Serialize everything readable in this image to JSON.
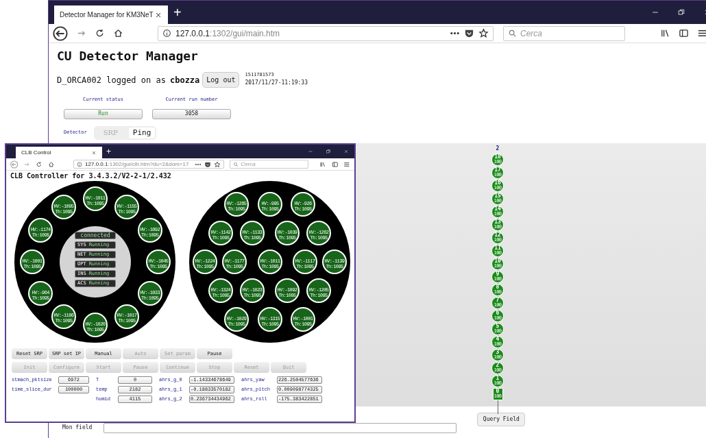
{
  "main_window": {
    "tab_title": "Detector Manager for KM3NeT",
    "new_tab": "+",
    "url_host": "127.0.0.1",
    "url_path": ":1302/gui/main.htm",
    "search_placeholder": "Cerca"
  },
  "page": {
    "title": "CU Detector Manager",
    "login_text": "D_ORCA002 logged on as",
    "user": "cbozza",
    "logout": "Log out",
    "timestamp": "1511781573",
    "datetime": "2017/11/27-11:19:33",
    "status_fields": [
      {
        "label": "Current status",
        "value": "Run",
        "kind": "status"
      },
      {
        "label": "Current run number",
        "value": "3058",
        "kind": "number"
      }
    ],
    "detector_label": "Detector",
    "detector_buttons": [
      {
        "label": "SRP",
        "disabled": true
      },
      {
        "label": "Ping",
        "disabled": false
      }
    ],
    "string": {
      "label": "2",
      "floors": [
        {
          "number": "18",
          "value": "100",
          "kind": "dom"
        },
        {
          "number": "17",
          "value": "100",
          "kind": "dom"
        },
        {
          "number": "16",
          "value": "100",
          "kind": "dom"
        },
        {
          "number": "15",
          "value": "100",
          "kind": "dom"
        },
        {
          "number": "14",
          "value": "100",
          "kind": "dom"
        },
        {
          "number": "13",
          "value": "100",
          "kind": "dom"
        },
        {
          "number": "12",
          "value": "100",
          "kind": "dom"
        },
        {
          "number": "11",
          "value": "100",
          "kind": "dom"
        },
        {
          "number": "10",
          "value": "100",
          "kind": "dom"
        },
        {
          "number": "9",
          "value": "100",
          "kind": "dom"
        },
        {
          "number": "8",
          "value": "100",
          "kind": "dom"
        },
        {
          "number": "7",
          "value": "100",
          "kind": "dom"
        },
        {
          "number": "6",
          "value": "100",
          "kind": "dom"
        },
        {
          "number": "5",
          "value": "100",
          "kind": "dom"
        },
        {
          "number": "4",
          "value": "100",
          "kind": "dom"
        },
        {
          "number": "3",
          "value": "100",
          "kind": "dom"
        },
        {
          "number": "2",
          "value": "100",
          "kind": "dom"
        },
        {
          "number": "1",
          "value": "100",
          "kind": "dom"
        },
        {
          "number": "0",
          "value": "100",
          "kind": "base"
        }
      ]
    },
    "mon_field_label": "Mon field",
    "query_button": "Query Field"
  },
  "clb_window": {
    "tab_title": "CLB Control",
    "new_tab": "+",
    "url_host": "127.0.0.1",
    "url_path": ":1302/gui/clb.htm?du=2&dom=17",
    "search_placeholder": "Cerca",
    "heading": "CLB Controller for 3.4.3.2/V2-2-1/2.432",
    "connection": "connected",
    "subsystems": [
      {
        "name": "SYS",
        "state": "Running"
      },
      {
        "name": "NET",
        "state": "Running"
      },
      {
        "name": "OPT",
        "state": "Running"
      },
      {
        "name": "INS",
        "state": "Running"
      },
      {
        "name": "ACS",
        "state": "Running"
      }
    ],
    "pmts_left": [
      {
        "hv": "HV:-1011",
        "th": "Th:1095"
      },
      {
        "hv": "HV:-1095",
        "th": "Th:1095"
      },
      {
        "hv": "HV:-1155",
        "th": "Th:1095"
      },
      {
        "hv": "HV:-1174",
        "th": "Th:1095"
      },
      {
        "hv": "HV:-1092",
        "th": "Th:1095"
      },
      {
        "hv": "HV:-1001",
        "th": "Th:1095"
      },
      {
        "hv": "HV:-1045",
        "th": "Th:1095"
      },
      {
        "hv": "HV:-964",
        "th": "Th:1095"
      },
      {
        "hv": "HV:-1033",
        "th": "Th:1095"
      },
      {
        "hv": "HV:-1186",
        "th": "Th:1095"
      },
      {
        "hv": "HV:-1017",
        "th": "Th:1095"
      },
      {
        "hv": "HV:-1020",
        "th": "Th:1095"
      }
    ],
    "pmts_right": [
      {
        "hv": "HV:-1265",
        "th": "Th:1095"
      },
      {
        "hv": "HV:-995",
        "th": "Th:1095"
      },
      {
        "hv": "HV:-926",
        "th": "Th:1095"
      },
      {
        "hv": "HV:-1142",
        "th": "Th:1095"
      },
      {
        "hv": "HV:-1133",
        "th": "Th:1095"
      },
      {
        "hv": "HV:-1039",
        "th": "Th:1095"
      },
      {
        "hv": "HV:-1262",
        "th": "Th:1095"
      },
      {
        "hv": "HV:-1224",
        "th": "Th:1095"
      },
      {
        "hv": "HV:-1177",
        "th": "Th:1095"
      },
      {
        "hv": "HV:-1011",
        "th": "Th:1095"
      },
      {
        "hv": "HV:-1117",
        "th": "Th:1095"
      },
      {
        "hv": "HV:-1139",
        "th": "Th:1095"
      },
      {
        "hv": "HV:-1324",
        "th": "Th:1095"
      },
      {
        "hv": "HV:-1023",
        "th": "Th:1095"
      },
      {
        "hv": "HV:-1092",
        "th": "Th:1095"
      },
      {
        "hv": "HV:-1205",
        "th": "Th:1095"
      },
      {
        "hv": "HV:-1029",
        "th": "Th:1095"
      },
      {
        "hv": "HV:-1315",
        "th": "Th:1095"
      },
      {
        "hv": "HV:-1001",
        "th": "Th:1095"
      }
    ],
    "button_rows": [
      [
        {
          "label": "Reset SRP",
          "disabled": false
        },
        {
          "label": "SRP set IP",
          "disabled": false
        },
        {
          "label": "Manual",
          "disabled": false
        },
        {
          "label": "Auto",
          "disabled": true
        },
        {
          "label": "Set param",
          "disabled": true
        },
        {
          "label": "Pause",
          "disabled": false
        }
      ],
      [
        {
          "label": "Init",
          "disabled": true
        },
        {
          "label": "Configure",
          "disabled": true
        },
        {
          "label": "Start",
          "disabled": true
        },
        {
          "label": "Pause",
          "disabled": true
        },
        {
          "label": "Continue",
          "disabled": true
        },
        {
          "label": "Stop",
          "disabled": true
        },
        {
          "label": "Reset",
          "disabled": true
        },
        {
          "label": "Quit",
          "disabled": true
        }
      ]
    ],
    "param_columns": [
      [
        {
          "label": "stmach_pktsize",
          "value": "6972"
        },
        {
          "label": "time_slice_dur",
          "value": "100000"
        }
      ],
      [
        {
          "label": "T",
          "value": "0"
        },
        {
          "label": "temp",
          "value": "2182"
        },
        {
          "label": "humid",
          "value": "4115"
        }
      ],
      [
        {
          "label": "ahrs_g_0",
          "value": "-1.14334678649"
        },
        {
          "label": "ahrs_g_1",
          "value": "-0.18833570182"
        },
        {
          "label": "ahrs_g_2",
          "value": "0.236734434962"
        }
      ],
      [
        {
          "label": "ahrs_yaw",
          "value": "226.2504577636"
        },
        {
          "label": "ahrs_pitch",
          "value": "0.009098774325"
        },
        {
          "label": "ahrs_roll",
          "value": "-175.383422851"
        }
      ]
    ]
  }
}
